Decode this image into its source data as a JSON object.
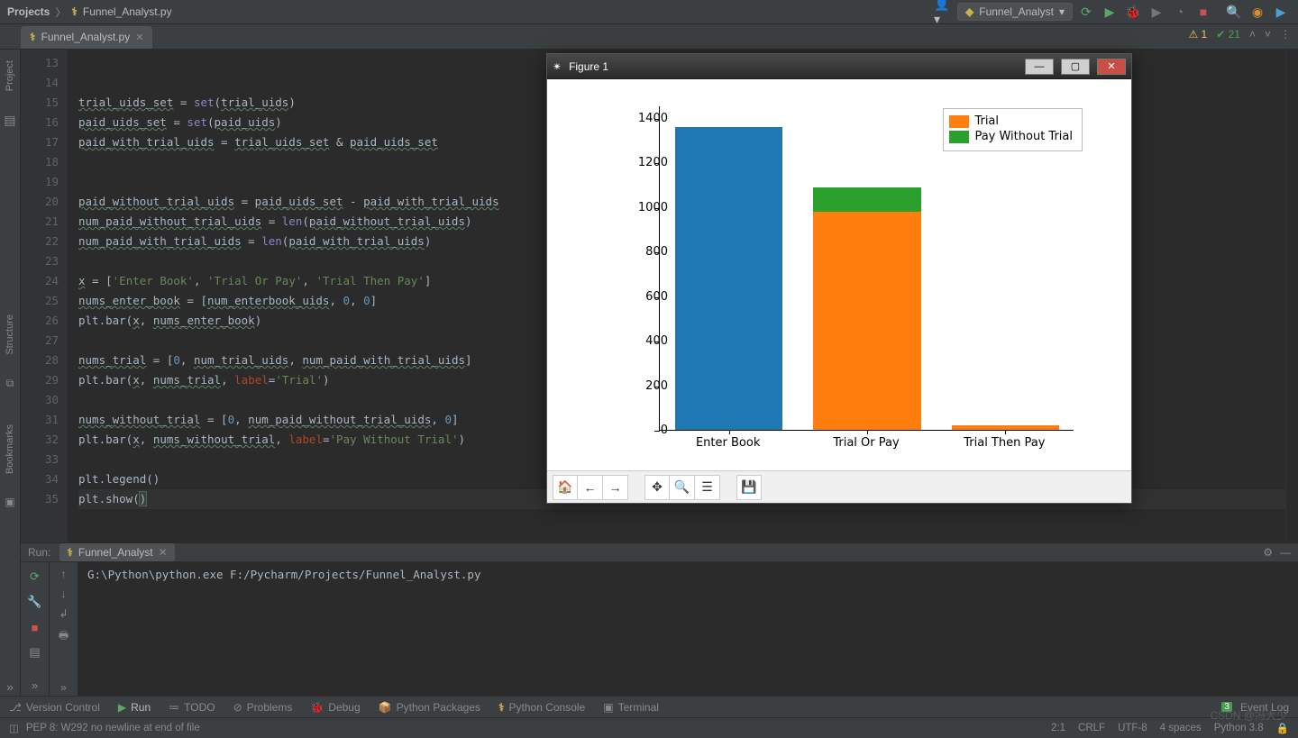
{
  "breadcrumb": {
    "project": "Projects",
    "file": "Funnel_Analyst.py"
  },
  "run_config": "Funnel_Analyst",
  "tabs": {
    "file": "Funnel_Analyst.py"
  },
  "inspections": {
    "warn": "1",
    "checks": "21"
  },
  "code": {
    "start_line": 13,
    "lines": [
      "",
      "",
      "trial_uids_set = set(trial_uids)",
      "paid_uids_set = set(paid_uids)",
      "paid_with_trial_uids = trial_uids_set & paid_uids_set",
      "",
      "",
      "paid_without_trial_uids = paid_uids_set - paid_with_trial_uids",
      "num_paid_without_trial_uids = len(paid_without_trial_uids)",
      "num_paid_with_trial_uids = len(paid_with_trial_uids)",
      "",
      "x = ['Enter Book', 'Trial Or Pay', 'Trial Then Pay']",
      "nums_enter_book = [num_enterbook_uids, 0, 0]",
      "plt.bar(x, nums_enter_book)",
      "",
      "nums_trial = [0, num_trial_uids, num_paid_with_trial_uids]",
      "plt.bar(x, nums_trial, label='Trial')",
      "",
      "nums_without_trial = [0, num_paid_without_trial_uids, 0]",
      "plt.bar(x, nums_without_trial, label='Pay Without Trial')",
      "",
      "plt.legend()",
      "plt.show()"
    ]
  },
  "run_panel": {
    "title": "Run:",
    "tab": "Funnel_Analyst",
    "output": "G:\\Python\\python.exe F:/Pycharm/Projects/Funnel_Analyst.py"
  },
  "bottom_tabs": {
    "version_control": "Version Control",
    "run": "Run",
    "todo": "TODO",
    "problems": "Problems",
    "debug": "Debug",
    "python_packages": "Python Packages",
    "python_console": "Python Console",
    "terminal": "Terminal",
    "event_log": "Event Log",
    "event_count": "3"
  },
  "status_bar": {
    "msg": "PEP 8: W292 no newline at end of file",
    "caret": "2:1",
    "line_sep": "CRLF",
    "encoding": "UTF-8",
    "indent": "4 spaces",
    "interpreter": "Python 3.8"
  },
  "left_tabs": {
    "project": "Project",
    "structure": "Structure",
    "bookmarks": "Bookmarks"
  },
  "figure": {
    "title": "Figure 1",
    "legend": [
      "Trial",
      "Pay Without Trial"
    ],
    "toolbar": [
      "home",
      "back",
      "forward",
      "move",
      "zoom",
      "configure",
      "save"
    ]
  },
  "chart_data": {
    "type": "bar",
    "stacked": true,
    "categories": [
      "Enter Book",
      "Trial Or Pay",
      "Trial Then Pay"
    ],
    "series": [
      {
        "name": "Enter Book (default)",
        "color": "#1f77b4",
        "values": [
          1360,
          0,
          0
        ]
      },
      {
        "name": "Trial",
        "color": "#ff7f0e",
        "values": [
          0,
          980,
          20
        ]
      },
      {
        "name": "Pay Without Trial",
        "color": "#2ca02c",
        "values": [
          0,
          110,
          0
        ]
      }
    ],
    "ylim": [
      0,
      1400
    ],
    "y_ticks": [
      0,
      200,
      400,
      600,
      800,
      1000,
      1200,
      1400
    ],
    "xlabel": "",
    "ylabel": "",
    "title": ""
  },
  "watermark": {
    "l1": "",
    "l2": "CSDN @冯大少"
  }
}
